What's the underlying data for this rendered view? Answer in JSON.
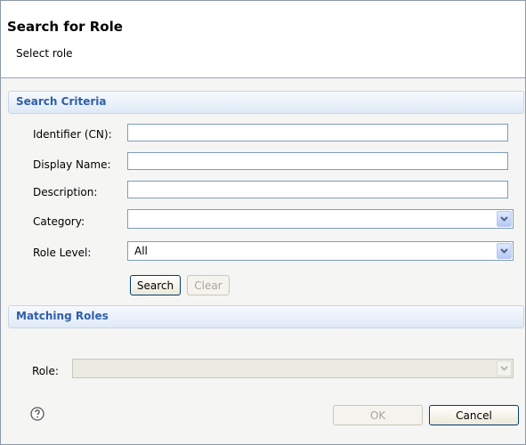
{
  "dialog": {
    "title": "Search for Role",
    "subtitle": "Select role"
  },
  "search_criteria": {
    "heading": "Search Criteria",
    "fields": {
      "identifier_label": "Identifier (CN):",
      "identifier_value": "",
      "display_name_label": "Display Name:",
      "display_name_value": "",
      "description_label": "Description:",
      "description_value": "",
      "category_label": "Category:",
      "category_value": "",
      "role_level_label": "Role Level:",
      "role_level_value": "All"
    },
    "search_label": "Search",
    "clear_label": "Clear"
  },
  "matching_roles": {
    "heading": "Matching Roles",
    "role_label": "Role:",
    "role_value": ""
  },
  "footer": {
    "ok_label": "OK",
    "cancel_label": "Cancel"
  },
  "icons": {
    "help": "help-icon",
    "dropdown": "chevron-down-icon"
  },
  "colors": {
    "section_heading": "#2e5ea9",
    "input_border": "#7f9db9",
    "button_border": "#003c74"
  }
}
